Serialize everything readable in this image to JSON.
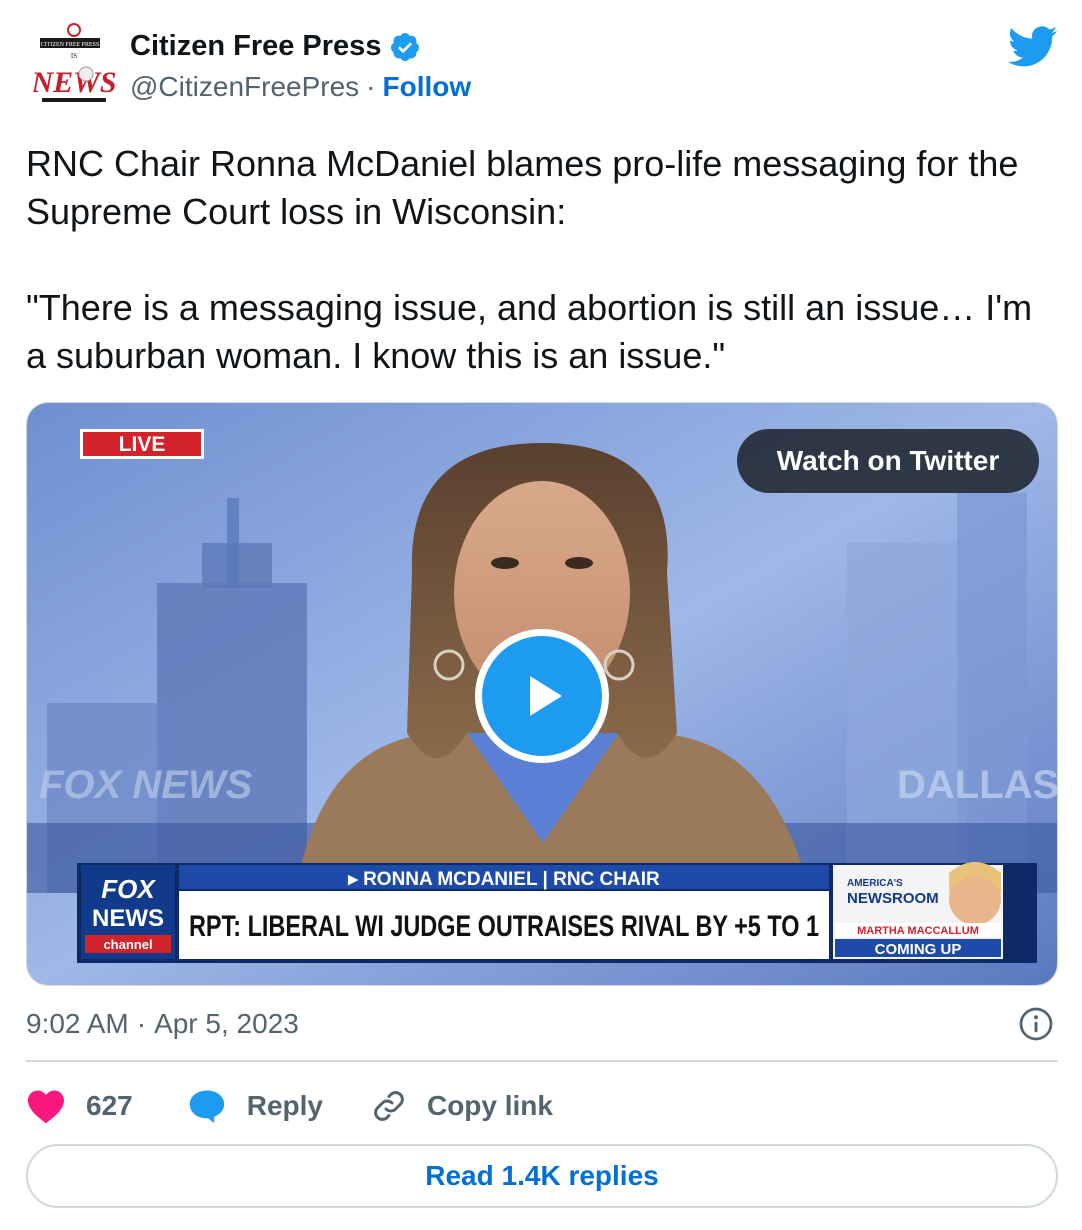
{
  "author": {
    "display_name": "Citizen Free Press",
    "handle": "@CitizenFreePres",
    "separator": "·",
    "follow_label": "Follow",
    "avatar_lines": [
      "CITIZEN FREE PRESS",
      "IS",
      "NEWS"
    ]
  },
  "tweet": {
    "text": "RNC Chair Ronna McDaniel blames pro-life messaging for the Supreme Court loss in Wisconsin:\n\n\"There is a messaging issue, and abortion is still an issue… I'm a suburban woman. I know this is an issue.\""
  },
  "media": {
    "watch_label": "Watch on Twitter",
    "live_badge": "LIVE",
    "bg_text_left": "FOX NEWS",
    "bg_text_right": "DALLAS",
    "lower_third_name": "▸ RONNA MCDANIEL | RNC CHAIR",
    "lower_third_headline": "RPT: LIBERAL WI JUDGE OUTRAISES RIVAL BY +5 TO 1",
    "logo_line1": "FOX",
    "logo_line2": "NEWS",
    "logo_line3": "channel",
    "promo_top1": "AMERICA'S",
    "promo_top2": "NEWSROOM",
    "promo_host": "MARTHA MACCALLUM",
    "promo_cta": "COMING UP"
  },
  "meta": {
    "time": "9:02 AM",
    "separator": "·",
    "date": "Apr 5, 2023"
  },
  "actions": {
    "likes": "627",
    "reply_label": "Reply",
    "copy_label": "Copy link"
  },
  "read_replies_label": "Read 1.4K replies",
  "colors": {
    "brand_blue": "#1d9bf0",
    "link_blue": "#006fd6",
    "heart_pink": "#f91880",
    "muted": "#536471",
    "fox_red": "#d2232a"
  }
}
